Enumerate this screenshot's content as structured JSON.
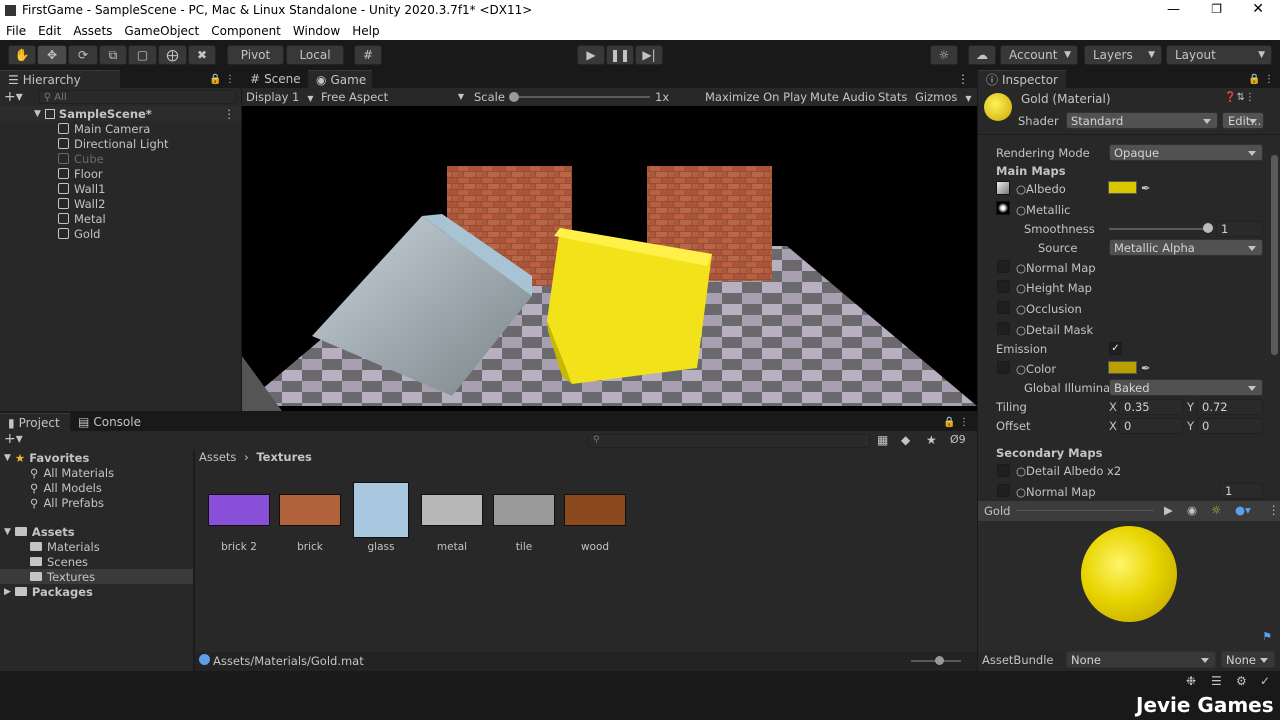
{
  "window": {
    "title": "FirstGame - SampleScene - PC, Mac & Linux Standalone - Unity 2020.3.7f1* <DX11>"
  },
  "menu": [
    "File",
    "Edit",
    "Assets",
    "GameObject",
    "Component",
    "Window",
    "Help"
  ],
  "toolbar": {
    "pivot": "Pivot",
    "local": "Local",
    "account": "Account",
    "layers": "Layers",
    "layout": "Layout"
  },
  "hierarchy": {
    "tab": "Hierarchy",
    "search_placeholder": "All",
    "scene": "SampleScene*",
    "items": [
      {
        "label": "Main Camera",
        "disabled": false
      },
      {
        "label": "Directional Light",
        "disabled": false
      },
      {
        "label": "Cube",
        "disabled": true
      },
      {
        "label": "Floor",
        "disabled": false
      },
      {
        "label": "Wall1",
        "disabled": false
      },
      {
        "label": "Wall2",
        "disabled": false
      },
      {
        "label": "Metal",
        "disabled": false
      },
      {
        "label": "Gold",
        "disabled": false
      }
    ]
  },
  "game": {
    "tab_scene": "Scene",
    "tab_game": "Game",
    "display": "Display 1",
    "aspect": "Free Aspect",
    "scale_label": "Scale",
    "scale_value": "1x",
    "maximize": "Maximize On Play",
    "mute": "Mute Audio",
    "stats": "Stats",
    "gizmos": "Gizmos"
  },
  "project": {
    "tab_project": "Project",
    "tab_console": "Console",
    "hidden_count": "9",
    "favorites": {
      "label": "Favorites",
      "items": [
        "All Materials",
        "All Models",
        "All Prefabs"
      ]
    },
    "assets": {
      "label": "Assets",
      "items": [
        "Materials",
        "Scenes",
        "Textures"
      ]
    },
    "packages": "Packages",
    "breadcrumb": [
      "Assets",
      "Textures"
    ],
    "textures": [
      {
        "label": "brick 2",
        "color": "#8a4fd9"
      },
      {
        "label": "brick",
        "color": "#b0623a"
      },
      {
        "label": "glass",
        "color": "#a8c8e0"
      },
      {
        "label": "metal",
        "color": "#b8b8b8"
      },
      {
        "label": "tile",
        "color": "#9a9a9a"
      },
      {
        "label": "wood",
        "color": "#8a4a1e"
      }
    ],
    "status_path": "Assets/Materials/Gold.mat"
  },
  "inspector": {
    "tab": "Inspector",
    "title": "Gold (Material)",
    "shader_label": "Shader",
    "shader": "Standard",
    "edit": "Edit...",
    "rendering_mode_label": "Rendering Mode",
    "rendering_mode": "Opaque",
    "main_maps": "Main Maps",
    "albedo": "Albedo",
    "metallic": "Metallic",
    "smoothness": "Smoothness",
    "smoothness_value": "1",
    "source_label": "Source",
    "source": "Metallic Alpha",
    "normal_map": "Normal Map",
    "height_map": "Height Map",
    "occlusion": "Occlusion",
    "detail_mask": "Detail Mask",
    "emission": "Emission",
    "color": "Color",
    "global_illum": "Global Illuminati",
    "global_illum_value": "Baked",
    "tiling": "Tiling",
    "tiling_x": "0.35",
    "tiling_y": "0.72",
    "offset": "Offset",
    "offset_x": "0",
    "offset_y": "0",
    "x": "X",
    "y": "Y",
    "secondary_maps": "Secondary Maps",
    "detail_albedo": "Detail Albedo x2",
    "normal_map2": "Normal Map",
    "normal_map2_value": "1",
    "preview_name": "Gold",
    "assetbundle_label": "AssetBundle",
    "assetbundle": "None",
    "assetbundle_variant": "None",
    "albedo_color": "#d9c800",
    "emission_color": "#b8a000"
  },
  "watermark": "Jevie Games"
}
